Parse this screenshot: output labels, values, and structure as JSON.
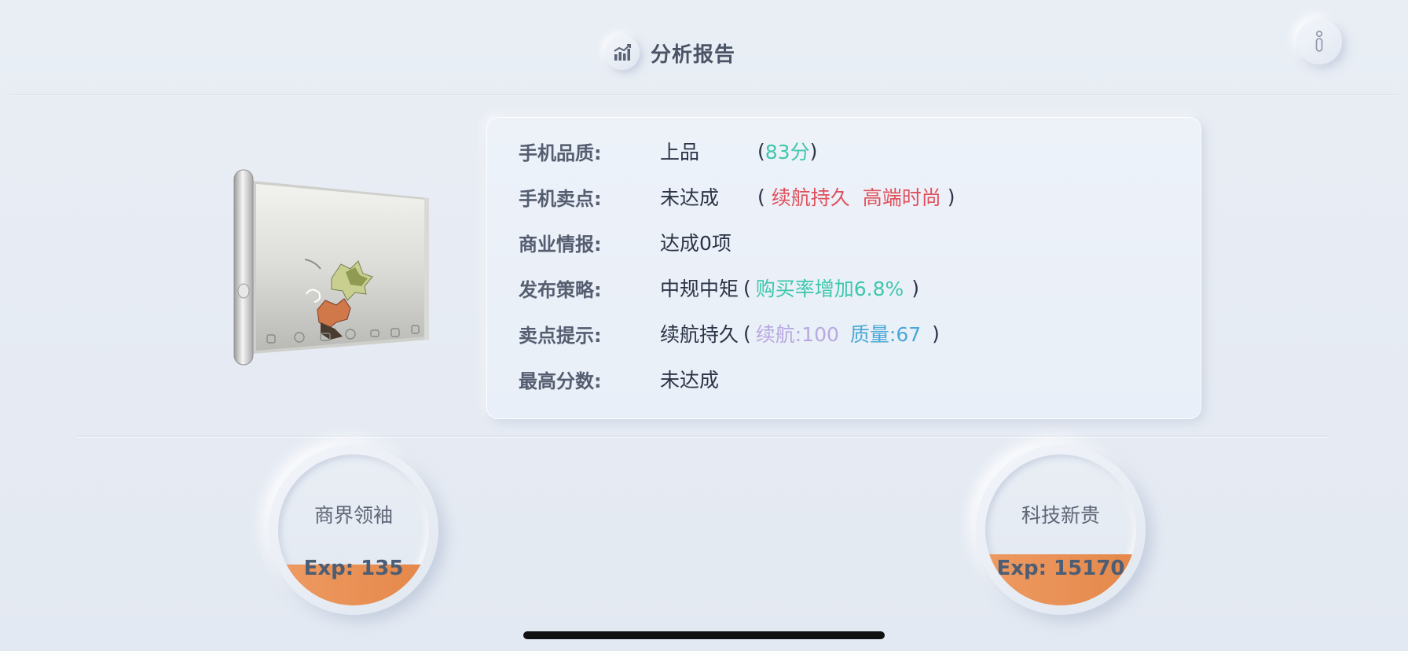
{
  "header": {
    "title": "分析报告",
    "title_icon": "bar-chart-icon",
    "info_icon": "info-icon"
  },
  "report": {
    "quality": {
      "label": "手机品质:",
      "value": "上品",
      "score_open": "(",
      "score": "83分",
      "score_close": ")"
    },
    "selling_points": {
      "label": "手机卖点:",
      "value": "未达成",
      "open": "(",
      "tag1": "续航持久",
      "tag2": "高端时尚",
      "close": ")"
    },
    "business_intel": {
      "label": "商业情报:",
      "value": "达成0项"
    },
    "launch_strategy": {
      "label": "发布策略:",
      "value": "中规中矩",
      "open": "(",
      "detail": "购买率增加6.8%",
      "close": ")"
    },
    "selling_hint": {
      "label": "卖点提示:",
      "value": "续航持久",
      "open": "(",
      "battery": "续航:100",
      "quality": "质量:67",
      "close": ")"
    },
    "high_score": {
      "label": "最高分数:",
      "value": "未达成"
    }
  },
  "exp_badges": [
    {
      "title": "商界领袖",
      "exp": "Exp: 135",
      "fill_fraction": 0.27
    },
    {
      "title": "科技新贵",
      "exp": "Exp: 15170",
      "fill_fraction": 0.34
    }
  ],
  "colors": {
    "teal": "#3ec7ad",
    "red": "#e0505c",
    "lavender": "#b8a8e0",
    "blue": "#4aa8d8",
    "orange": "#e8904f"
  }
}
